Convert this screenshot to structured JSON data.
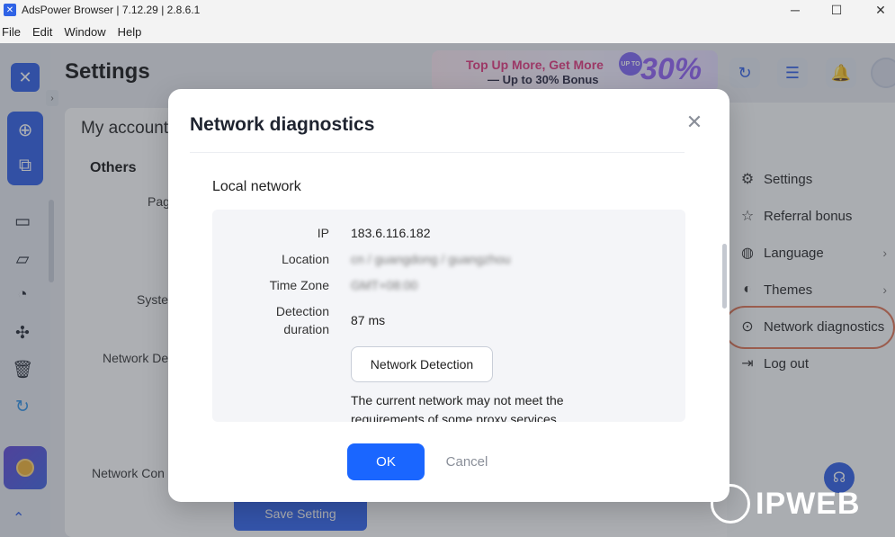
{
  "window": {
    "title": "AdsPower Browser | 7.12.29 | 2.8.6.1",
    "minimize": "─",
    "maximize": "☐",
    "close": "✕"
  },
  "menubar": [
    "File",
    "Edit",
    "Window",
    "Help"
  ],
  "page": {
    "title": "Settings",
    "my_account": "My account",
    "others": "Others",
    "frag_page": "Pag",
    "frag_system": "Syste",
    "frag_network_detect": "Network De",
    "frag_network_conn": "Network Con",
    "save_button": "Save Setting"
  },
  "promo": {
    "line1": "Top Up More, Get More",
    "line2": "— Up to 30% Bonus",
    "big": "30%",
    "badge": "UP TO"
  },
  "side_menu": {
    "items": [
      {
        "label": "Settings",
        "icon": "gear-icon",
        "glyph": "⚙"
      },
      {
        "label": "Referral bonus",
        "icon": "star-icon",
        "glyph": "☆"
      },
      {
        "label": "Language",
        "icon": "globe-icon",
        "glyph": "◍"
      },
      {
        "label": "Themes",
        "icon": "palette-icon",
        "glyph": "◐"
      },
      {
        "label": "Network diagnostics",
        "icon": "plug-icon",
        "glyph": "⊙"
      },
      {
        "label": "Log out",
        "icon": "logout-icon",
        "glyph": "⇥"
      }
    ]
  },
  "modal": {
    "title": "Network diagnostics",
    "close": "✕",
    "section": "Local network",
    "ip_label": "IP",
    "ip_value": "183.6.116.182",
    "location_label": "Location",
    "location_value": "cn / guangdong / guangzhou",
    "timezone_label": "Time Zone",
    "timezone_value": "GMT+08:00",
    "duration_label_1": "Detection",
    "duration_label_2": "duration",
    "duration_value": "87 ms",
    "detect_button": "Network Detection",
    "warning": "The current network may not meet the requirements of some proxy services.",
    "ok": "OK",
    "cancel": "Cancel"
  },
  "watermark": "IPWEB"
}
